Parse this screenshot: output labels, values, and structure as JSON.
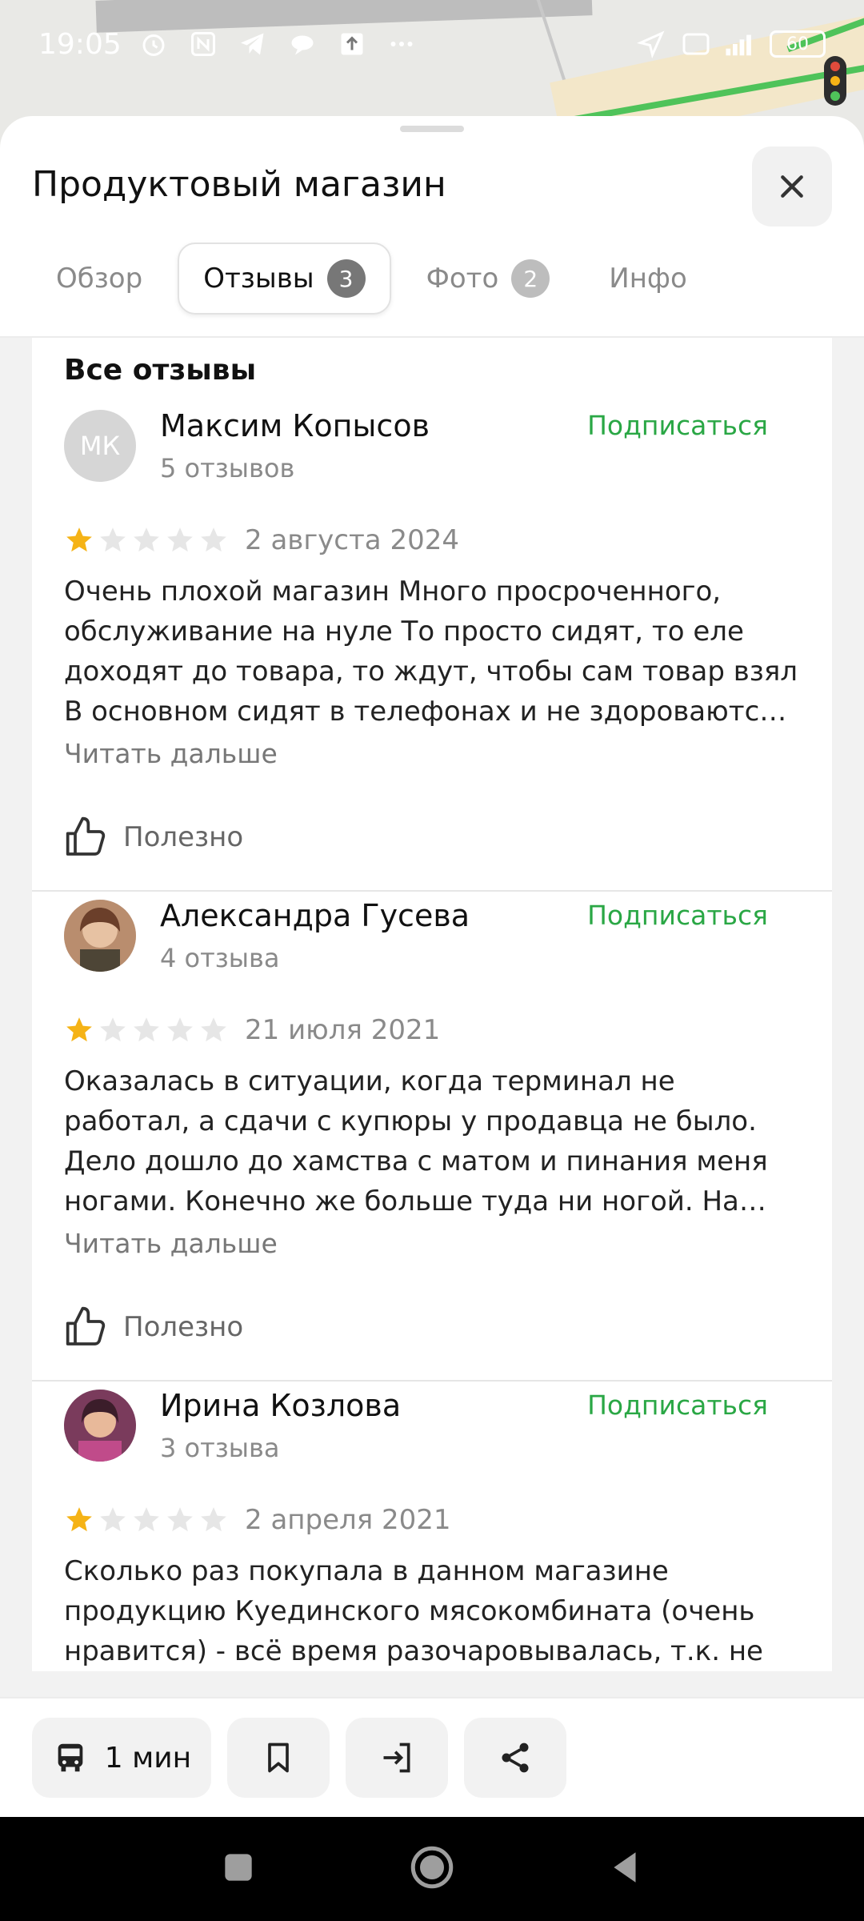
{
  "status_bar": {
    "time": "19:05",
    "battery": "60",
    "network": "4G"
  },
  "sheet": {
    "title": "Продуктовый магазин",
    "tabs": [
      {
        "label": "Обзор",
        "count": ""
      },
      {
        "label": "Отзывы",
        "count": "3"
      },
      {
        "label": "Фото",
        "count": "2"
      },
      {
        "label": "Инфо",
        "count": ""
      }
    ],
    "active_tab": "Отзывы"
  },
  "reviews_section": {
    "title": "Все отзывы",
    "subscribe_label": "Подписаться",
    "read_more_label": "Читать дальше",
    "helpful_label": "Полезно",
    "items": [
      {
        "initials": "МК",
        "author": "Максим Копысов",
        "count": "5 отзывов",
        "rating": 1,
        "date": "2 августа 2024",
        "text": "Очень плохой магазин Много просроченного, обслуживание на нуле То просто сидят, то еле доходят до товара, то ждут, чтобы сам товар взял В основном сидят в телефонах и не здороваютс…"
      },
      {
        "initials": "",
        "author": "Александра Гусева",
        "count": "4 отзыва",
        "rating": 1,
        "date": "21 июля 2021",
        "text": "Оказалась в ситуации, когда терминал не работал, а сдачи с купюры у продавца не было. Дело дошло до хамства с матом и пинания меня ногами. Конечно же больше туда ни ногой. На…"
      },
      {
        "initials": "",
        "author": "Ирина Козлова",
        "count": "3 отзыва",
        "rating": 1,
        "date": "2 апреля 2021",
        "text": "Сколько раз покупала в данном магазине продукцию Куединского мясокомбината (очень нравится) - всё время разочаровывалась, т.к. не"
      }
    ]
  },
  "bottom_bar": {
    "transit_time": "1 мин"
  },
  "colors": {
    "accent_green": "#2aa745",
    "star_filled": "#f5b316",
    "star_empty": "#e6e6e6"
  }
}
